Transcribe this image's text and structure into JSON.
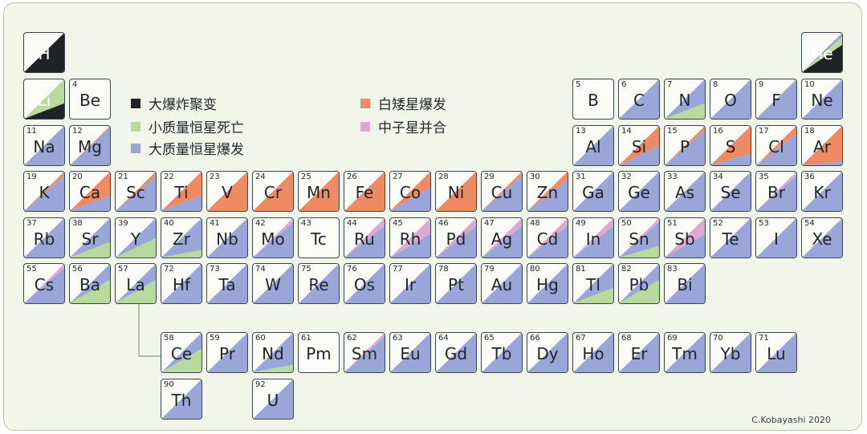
{
  "legend": [
    {
      "label": "大爆炸聚变",
      "color": "#1f2326"
    },
    {
      "label": "小质量恒星死亡",
      "color": "#b8da9c"
    },
    {
      "label": "大质量恒星爆发",
      "color": "#9ba6d8"
    },
    {
      "label": "白矮星爆发",
      "color": "#ee8a64"
    },
    {
      "label": "中子星并合",
      "color": "#dcaad0"
    }
  ],
  "credit": "C.Kobayashi 2020",
  "colors": {
    "big_bang": "#1f2326",
    "low_mass": "#b8da9c",
    "massive": "#9ba6d8",
    "white_dwarf": "#ee8a64",
    "merger": "#dcaad0"
  },
  "elements": [
    {
      "z": "1",
      "sym": "H",
      "p": [
        1,
        0,
        0,
        0,
        0
      ]
    },
    {
      "z": "2",
      "sym": "He",
      "p": [
        0.85,
        0.1,
        0.05,
        0,
        0
      ]
    },
    {
      "z": "3",
      "sym": "Li",
      "p": [
        0.7,
        0.3,
        0,
        0,
        0
      ]
    },
    {
      "z": "4",
      "sym": "Be",
      "p": [
        0,
        0,
        0,
        0,
        0
      ]
    },
    {
      "z": "5",
      "sym": "B",
      "p": [
        0,
        0,
        0,
        0,
        0
      ]
    },
    {
      "z": "6",
      "sym": "C",
      "p": [
        0,
        0.5,
        0.5,
        0,
        0
      ]
    },
    {
      "z": "7",
      "sym": "N",
      "p": [
        0,
        0.7,
        0.3,
        0,
        0
      ]
    },
    {
      "z": "8",
      "sym": "O",
      "p": [
        0,
        0.05,
        0.95,
        0,
        0
      ]
    },
    {
      "z": "9",
      "sym": "F",
      "p": [
        0,
        0.5,
        0.5,
        0,
        0
      ]
    },
    {
      "z": "10",
      "sym": "Ne",
      "p": [
        0,
        0.05,
        0.95,
        0,
        0
      ]
    },
    {
      "z": "11",
      "sym": "Na",
      "p": [
        0,
        0.1,
        0.9,
        0,
        0
      ]
    },
    {
      "z": "12",
      "sym": "Mg",
      "p": [
        0,
        0.05,
        0.93,
        0.02,
        0
      ]
    },
    {
      "z": "13",
      "sym": "Al",
      "p": [
        0,
        0.1,
        0.9,
        0,
        0
      ]
    },
    {
      "z": "14",
      "sym": "Si",
      "p": [
        0,
        0,
        0.75,
        0.25,
        0
      ]
    },
    {
      "z": "15",
      "sym": "P",
      "p": [
        0,
        0,
        0.95,
        0.05,
        0
      ]
    },
    {
      "z": "16",
      "sym": "S",
      "p": [
        0,
        0,
        0.65,
        0.35,
        0
      ]
    },
    {
      "z": "17",
      "sym": "Cl",
      "p": [
        0,
        0,
        0.9,
        0.1,
        0
      ]
    },
    {
      "z": "18",
      "sym": "Ar",
      "p": [
        0,
        0,
        0.55,
        0.45,
        0
      ]
    },
    {
      "z": "19",
      "sym": "K",
      "p": [
        0,
        0,
        0.95,
        0.05,
        0
      ]
    },
    {
      "z": "20",
      "sym": "Ca",
      "p": [
        0,
        0,
        0.7,
        0.3,
        0
      ]
    },
    {
      "z": "21",
      "sym": "Sc",
      "p": [
        0,
        0,
        0.95,
        0.05,
        0
      ]
    },
    {
      "z": "22",
      "sym": "Ti",
      "p": [
        0,
        0,
        0.7,
        0.3,
        0
      ]
    },
    {
      "z": "23",
      "sym": "V",
      "p": [
        0,
        0,
        0.5,
        0.5,
        0
      ]
    },
    {
      "z": "24",
      "sym": "Cr",
      "p": [
        0,
        0,
        0.4,
        0.6,
        0
      ]
    },
    {
      "z": "25",
      "sym": "Mn",
      "p": [
        0,
        0,
        0.2,
        0.8,
        0
      ]
    },
    {
      "z": "26",
      "sym": "Fe",
      "p": [
        0,
        0,
        0.4,
        0.6,
        0
      ]
    },
    {
      "z": "27",
      "sym": "Co",
      "p": [
        0,
        0,
        0.8,
        0.2,
        0
      ]
    },
    {
      "z": "28",
      "sym": "Ni",
      "p": [
        0,
        0,
        0.35,
        0.65,
        0
      ]
    },
    {
      "z": "29",
      "sym": "Cu",
      "p": [
        0,
        0.05,
        0.9,
        0.05,
        0
      ]
    },
    {
      "z": "30",
      "sym": "Zn",
      "p": [
        0,
        0.05,
        0.85,
        0.1,
        0
      ]
    },
    {
      "z": "31",
      "sym": "Ga",
      "p": [
        0,
        0.1,
        0.9,
        0,
        0
      ]
    },
    {
      "z": "32",
      "sym": "Ge",
      "p": [
        0,
        0.15,
        0.85,
        0,
        0
      ]
    },
    {
      "z": "33",
      "sym": "As",
      "p": [
        0,
        0.15,
        0.85,
        0,
        0
      ]
    },
    {
      "z": "34",
      "sym": "Se",
      "p": [
        0,
        0.2,
        0.8,
        0,
        0
      ]
    },
    {
      "z": "35",
      "sym": "Br",
      "p": [
        0,
        0.2,
        0.75,
        0,
        0.05
      ]
    },
    {
      "z": "36",
      "sym": "Kr",
      "p": [
        0,
        0.25,
        0.75,
        0,
        0
      ]
    },
    {
      "z": "37",
      "sym": "Rb",
      "p": [
        0,
        0.3,
        0.7,
        0,
        0
      ]
    },
    {
      "z": "38",
      "sym": "Sr",
      "p": [
        0,
        0.7,
        0.3,
        0,
        0
      ]
    },
    {
      "z": "39",
      "sym": "Y",
      "p": [
        0,
        0.75,
        0.25,
        0,
        0
      ]
    },
    {
      "z": "40",
      "sym": "Zr",
      "p": [
        0,
        0.6,
        0.4,
        0,
        0
      ]
    },
    {
      "z": "41",
      "sym": "Nb",
      "p": [
        0,
        0.5,
        0.5,
        0,
        0
      ]
    },
    {
      "z": "42",
      "sym": "Mo",
      "p": [
        0,
        0.5,
        0.45,
        0,
        0.05
      ]
    },
    {
      "z": "43",
      "sym": "Tc",
      "p": [
        0,
        0,
        0,
        0,
        0
      ]
    },
    {
      "z": "44",
      "sym": "Ru",
      "p": [
        0,
        0.3,
        0.6,
        0,
        0.1
      ]
    },
    {
      "z": "45",
      "sym": "Rh",
      "p": [
        0,
        0.2,
        0.6,
        0,
        0.2
      ]
    },
    {
      "z": "46",
      "sym": "Pd",
      "p": [
        0,
        0.4,
        0.5,
        0,
        0.1
      ]
    },
    {
      "z": "47",
      "sym": "Ag",
      "p": [
        0,
        0.2,
        0.7,
        0,
        0.1
      ]
    },
    {
      "z": "48",
      "sym": "Cd",
      "p": [
        0,
        0.5,
        0.4,
        0,
        0.1
      ]
    },
    {
      "z": "49",
      "sym": "In",
      "p": [
        0,
        0.5,
        0.4,
        0,
        0.1
      ]
    },
    {
      "z": "50",
      "sym": "Sn",
      "p": [
        0,
        0.65,
        0.3,
        0,
        0.05
      ]
    },
    {
      "z": "51",
      "sym": "Sb",
      "p": [
        0,
        0.3,
        0.5,
        0,
        0.2
      ]
    },
    {
      "z": "52",
      "sym": "Te",
      "p": [
        0,
        0.2,
        0.8,
        0,
        0
      ]
    },
    {
      "z": "53",
      "sym": "I",
      "p": [
        0,
        0.1,
        0.9,
        0,
        0
      ]
    },
    {
      "z": "54",
      "sym": "Xe",
      "p": [
        0,
        0.2,
        0.8,
        0,
        0
      ]
    },
    {
      "z": "55",
      "sym": "Cs",
      "p": [
        0,
        0.15,
        0.8,
        0,
        0.05
      ]
    },
    {
      "z": "56",
      "sym": "Ba",
      "p": [
        0,
        0.8,
        0.2,
        0,
        0
      ]
    },
    {
      "z": "57",
      "sym": "La",
      "p": [
        0,
        0.8,
        0.2,
        0,
        0
      ]
    },
    {
      "z": "58",
      "sym": "Ce",
      "p": [
        0,
        0.8,
        0.2,
        0,
        0
      ]
    },
    {
      "z": "59",
      "sym": "Pr",
      "p": [
        0,
        0.5,
        0.5,
        0,
        0
      ]
    },
    {
      "z": "60",
      "sym": "Nd",
      "p": [
        0,
        0.6,
        0.4,
        0,
        0
      ]
    },
    {
      "z": "61",
      "sym": "Pm",
      "p": [
        0,
        0,
        0,
        0,
        0
      ]
    },
    {
      "z": "62",
      "sym": "Sm",
      "p": [
        0,
        0.3,
        0.65,
        0,
        0.05
      ]
    },
    {
      "z": "63",
      "sym": "Eu",
      "p": [
        0,
        0.05,
        0.95,
        0,
        0
      ]
    },
    {
      "z": "64",
      "sym": "Gd",
      "p": [
        0,
        0.15,
        0.85,
        0,
        0
      ]
    },
    {
      "z": "65",
      "sym": "Tb",
      "p": [
        0,
        0.1,
        0.9,
        0,
        0
      ]
    },
    {
      "z": "66",
      "sym": "Dy",
      "p": [
        0,
        0.15,
        0.85,
        0,
        0
      ]
    },
    {
      "z": "67",
      "sym": "Ho",
      "p": [
        0,
        0.1,
        0.9,
        0,
        0
      ]
    },
    {
      "z": "68",
      "sym": "Er",
      "p": [
        0,
        0.15,
        0.85,
        0,
        0
      ]
    },
    {
      "z": "69",
      "sym": "Tm",
      "p": [
        0,
        0.1,
        0.9,
        0,
        0
      ]
    },
    {
      "z": "70",
      "sym": "Yb",
      "p": [
        0,
        0.3,
        0.7,
        0,
        0
      ]
    },
    {
      "z": "71",
      "sym": "Lu",
      "p": [
        0,
        0.15,
        0.85,
        0,
        0
      ]
    },
    {
      "z": "72",
      "sym": "Hf",
      "p": [
        0,
        0.4,
        0.6,
        0,
        0
      ]
    },
    {
      "z": "73",
      "sym": "Ta",
      "p": [
        0,
        0.4,
        0.6,
        0,
        0
      ]
    },
    {
      "z": "74",
      "sym": "W",
      "p": [
        0,
        0.5,
        0.5,
        0,
        0
      ]
    },
    {
      "z": "75",
      "sym": "Re",
      "p": [
        0,
        0.1,
        0.9,
        0,
        0
      ]
    },
    {
      "z": "76",
      "sym": "Os",
      "p": [
        0,
        0.05,
        0.95,
        0,
        0
      ]
    },
    {
      "z": "77",
      "sym": "Ir",
      "p": [
        0,
        0.05,
        0.95,
        0,
        0
      ]
    },
    {
      "z": "78",
      "sym": "Pt",
      "p": [
        0,
        0.05,
        0.95,
        0,
        0
      ]
    },
    {
      "z": "79",
      "sym": "Au",
      "p": [
        0,
        0.05,
        0.95,
        0,
        0
      ]
    },
    {
      "z": "80",
      "sym": "Hg",
      "p": [
        0,
        0.3,
        0.7,
        0,
        0
      ]
    },
    {
      "z": "81",
      "sym": "Tl",
      "p": [
        0,
        0.7,
        0.3,
        0,
        0
      ]
    },
    {
      "z": "82",
      "sym": "Pb",
      "p": [
        0,
        0.8,
        0.2,
        0,
        0
      ]
    },
    {
      "z": "83",
      "sym": "Bi",
      "p": [
        0,
        0.2,
        0.8,
        0,
        0
      ]
    },
    {
      "z": "90",
      "sym": "Th",
      "p": [
        0,
        0,
        1,
        0,
        0
      ]
    },
    {
      "z": "92",
      "sym": "U",
      "p": [
        0,
        0,
        1,
        0,
        0
      ]
    }
  ]
}
